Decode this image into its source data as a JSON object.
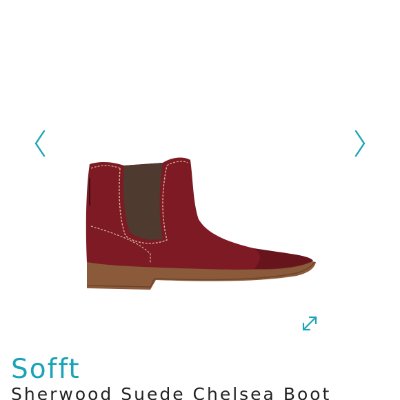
{
  "brand": {
    "name": "Sofft",
    "color": "#1aa3b5"
  },
  "product": {
    "name": "Sherwood Suede Chelsea Boot",
    "image_icon": "boot-image",
    "colors": {
      "suede": "#7d1a23",
      "elastic": "#4f3a30",
      "sole": "#8a5a3b",
      "stitching": "#d8b89a"
    }
  },
  "gallery": {
    "prev_icon": "chevron-left-icon",
    "next_icon": "chevron-right-icon",
    "expand_icon": "expand-icon",
    "accent": "#1aa3b5"
  }
}
